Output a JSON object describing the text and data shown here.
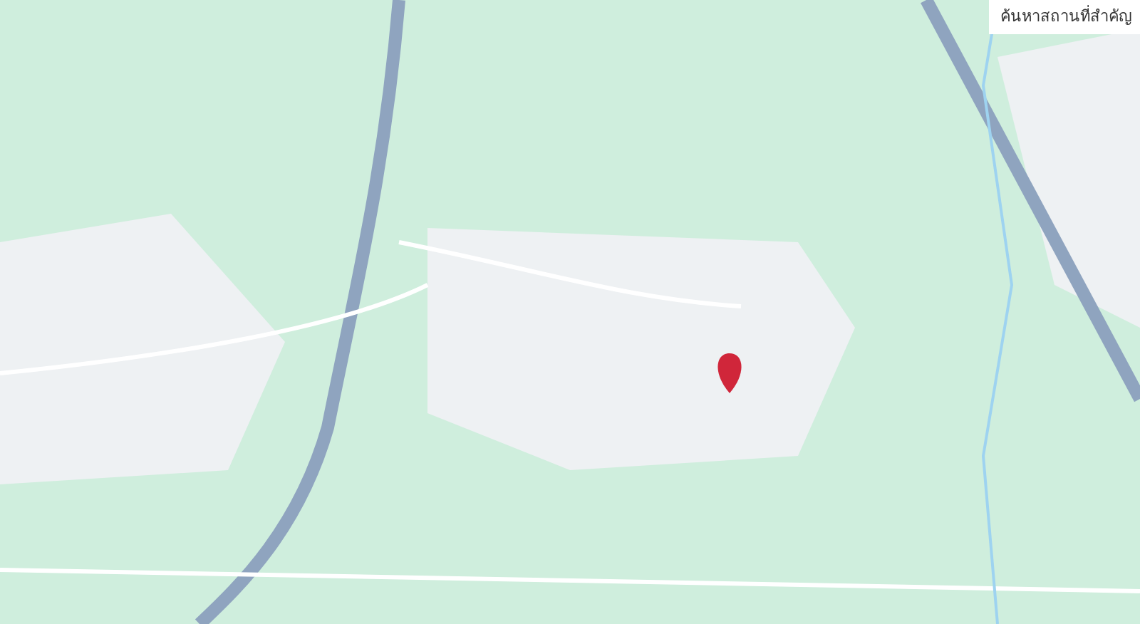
{
  "map": {
    "search_label": "ค้นหาสถานที่สำคัญ"
  }
}
